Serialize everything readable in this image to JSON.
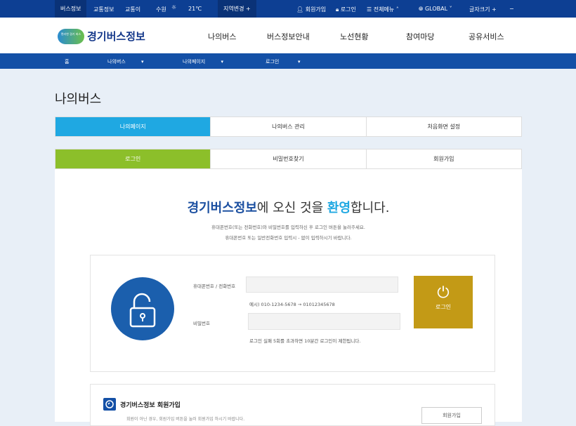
{
  "topbar": {
    "items": [
      "버스정보",
      "교통정보",
      "교통이",
      "수원",
      "21℃",
      "지역변경 +"
    ],
    "right": [
      "회원가입",
      "로그인",
      "전체메뉴",
      "GLOBAL",
      "글자크기 +",
      "−"
    ]
  },
  "header": {
    "logo_badge": "편리한 경기 버스",
    "logo": "경기버스정보",
    "nav": [
      "나의버스",
      "버스정보안내",
      "노선현황",
      "참여마당",
      "공유서비스"
    ]
  },
  "subnav": [
    "홈",
    "나의버스",
    "나의페이지",
    "로그인"
  ],
  "page_title": "나의버스",
  "tabs1": [
    "나의페이지",
    "나의버스 관리",
    "처음화면 설정"
  ],
  "tabs2": [
    "로그인",
    "비밀번호찾기",
    "회원가입"
  ],
  "welcome": {
    "part1": "경기버스정보",
    "part2": "에 오신 것을 ",
    "part3": "환영",
    "part4": "합니다."
  },
  "desc": [
    "휴대폰번호(또는 전화번호)와 비밀번호를 입력하신 후 로그인 버튼을 눌러주세요.",
    "휴대폰번호 또는 일반전화번호 입력시 - 없이 입력하시기 바랍니다."
  ],
  "form": {
    "phone_label": "휴대폰번호 / 전화번호",
    "phone_hint": "예시) 010-1234-5678 → 01012345678",
    "pw_label": "비밀번호",
    "pw_hint": "로그인 실패 5회를 초과하면 10분간 로그인이 제한됩니다.",
    "login": "로그인"
  },
  "join": {
    "title": "경기버스정보 회원가입",
    "desc": "회원이 아닌 경우, 회원가입 버튼을 눌러 회원가입 하시기 바랍니다.",
    "button": "회원가입"
  },
  "colors": {
    "top": "#0d3f93",
    "tab_active": "#1fa8e2",
    "tab2_active": "#8cbf2a",
    "login": "#c39a16"
  }
}
